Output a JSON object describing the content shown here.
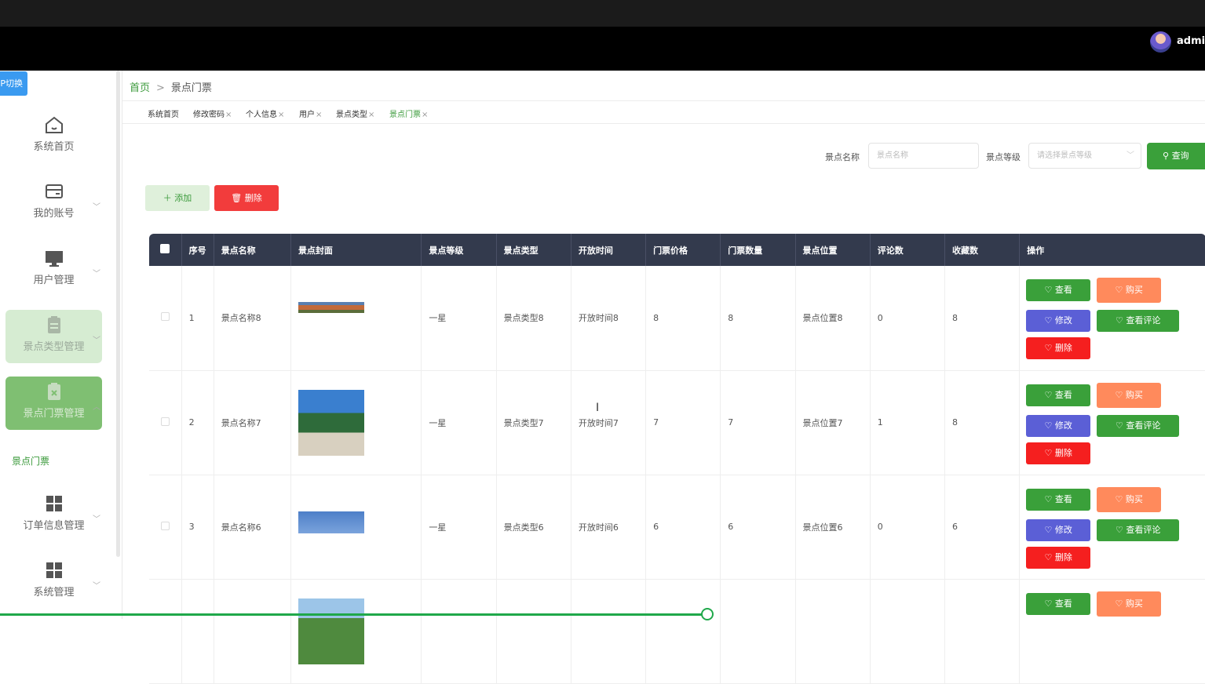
{
  "header": {
    "username": "admin"
  },
  "sidebar": {
    "switch_label": "P切换",
    "items": [
      {
        "label": "系统首页",
        "icon": "home-icon"
      },
      {
        "label": "我的账号",
        "icon": "account-icon"
      },
      {
        "label": "用户管理",
        "icon": "monitor-icon"
      },
      {
        "label": "景点类型管理",
        "icon": "clipboard-icon"
      },
      {
        "label": "景点门票管理",
        "icon": "clipboard-x-icon"
      },
      {
        "label": "订单信息管理",
        "icon": "grid-icon"
      },
      {
        "label": "系统管理",
        "icon": "grid-icon"
      }
    ],
    "submenu_active": "景点门票"
  },
  "breadcrumb": {
    "home": "首页",
    "sep": ">",
    "current": "景点门票"
  },
  "tabs": [
    {
      "label": "系统首页",
      "closable": false
    },
    {
      "label": "修改密码",
      "closable": true
    },
    {
      "label": "个人信息",
      "closable": true
    },
    {
      "label": "用户",
      "closable": true
    },
    {
      "label": "景点类型",
      "closable": true
    },
    {
      "label": "景点门票",
      "closable": true,
      "active": true
    }
  ],
  "search": {
    "name_label": "景点名称",
    "name_placeholder": "景点名称",
    "level_label": "景点等级",
    "level_placeholder": "请选择景点等级",
    "query_label": "查询"
  },
  "actions": {
    "add_label": "添加",
    "delete_label": "删除"
  },
  "table": {
    "headers": [
      "序号",
      "景点名称",
      "景点封面",
      "景点等级",
      "景点类型",
      "开放时间",
      "门票价格",
      "门票数量",
      "景点位置",
      "评论数",
      "收藏数",
      "操作"
    ],
    "rows": [
      {
        "index": "1",
        "name": "景点名称8",
        "level": "一星",
        "type": "景点类型8",
        "open_time": "开放时间8",
        "price": "8",
        "quantity": "8",
        "location": "景点位置8",
        "comments": "0",
        "favorites": "8"
      },
      {
        "index": "2",
        "name": "景点名称7",
        "level": "一星",
        "type": "景点类型7",
        "open_time": "开放时间7",
        "price": "7",
        "quantity": "7",
        "location": "景点位置7",
        "comments": "1",
        "favorites": "8"
      },
      {
        "index": "3",
        "name": "景点名称6",
        "level": "一星",
        "type": "景点类型6",
        "open_time": "开放时间6",
        "price": "6",
        "quantity": "6",
        "location": "景点位置6",
        "comments": "0",
        "favorites": "6"
      },
      {
        "index": "",
        "name": "",
        "level": "",
        "type": "",
        "open_time": "",
        "price": "",
        "quantity": "",
        "location": "",
        "comments": "",
        "favorites": ""
      }
    ],
    "op_labels": {
      "view": "查看",
      "buy": "购买",
      "edit": "修改",
      "review": "查看评论",
      "remove": "删除"
    }
  },
  "colors": {
    "primary": "#3aa03a",
    "danger": "#f23c3c",
    "header_bg": "#333a4d",
    "edit": "#5b5fd6",
    "buy": "#ff8a5c"
  }
}
